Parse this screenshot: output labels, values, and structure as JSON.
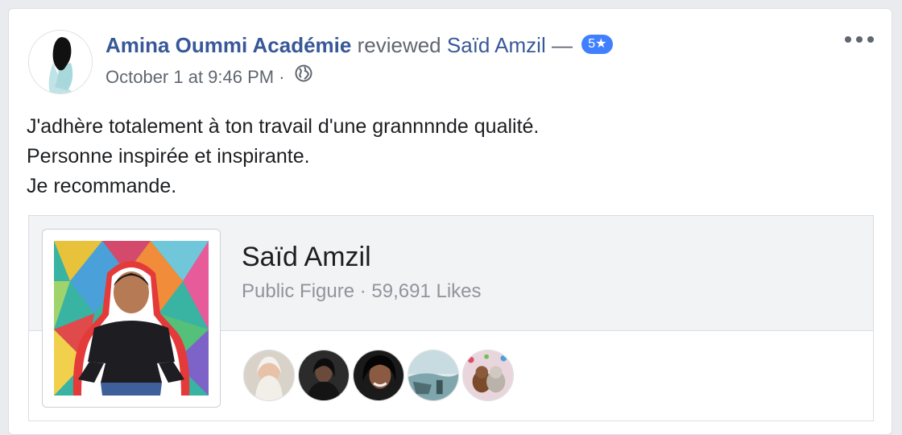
{
  "post": {
    "author": "Amina Oummi Académie",
    "action": "reviewed",
    "target_page": "Saïd Amzil",
    "separator": "—",
    "rating_label": "5★",
    "timestamp": "October 1 at 9:46 PM",
    "dot": "·",
    "privacy_icon": "globe-icon",
    "more_icon": "more-options-icon"
  },
  "review": {
    "lines": [
      "J'adhère totalement à ton travail d'une grannnnde qualité.",
      "Personne inspirée et inspirante.",
      "Je recommande."
    ]
  },
  "page_card": {
    "name": "Saïd Amzil",
    "category": "Public Figure",
    "dot": "·",
    "likes": "59,691 Likes",
    "liker_count": 5
  },
  "colors": {
    "link": "#385898",
    "badge": "#4080ff",
    "secondary_text": "#606770",
    "card_bg": "#f2f3f5"
  }
}
